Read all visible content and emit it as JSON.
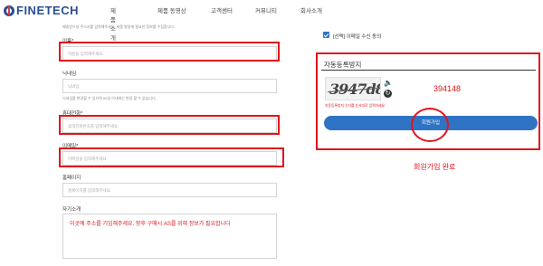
{
  "header": {
    "logo_text": "FINETECH",
    "nav": [
      "제품소개",
      "제품 동영상",
      "고객센터",
      "커뮤니티",
      "회사소개"
    ]
  },
  "form": {
    "top_hint": "배송받으실 주소지를 입력해주세요. 제품 발송에 필요한 정보를 수집합니다.",
    "name": {
      "label": "이름*",
      "placeholder": "이름을 입력해주세요."
    },
    "nickname": {
      "label": "닉네임",
      "placeholder": "닉네임",
      "note": "닉네임을 변경할 수 있으며 60일 이내에는 변경 할 수 없습니다."
    },
    "phone": {
      "label": "휴대전화*",
      "placeholder": "휴대전화번호를 입력해주세요."
    },
    "email": {
      "label": "이메일*",
      "placeholder": "이메일을 입력해주세요."
    },
    "homepage": {
      "label": "홈페이지",
      "placeholder": "홈페이지를 입력해주세요."
    },
    "intro": {
      "label": "자기소개",
      "text": "이곳에 주소를 기입해주세요. 향후 구매시 AS를 위해 정보가 필요합니다"
    }
  },
  "right": {
    "email_opt_in": "[선택] 이메일 수신 동의",
    "captcha": {
      "title": "자동등록방지",
      "image_text": "3947d8",
      "sound_icon": "speaker-icon",
      "refresh_icon": "refresh-icon",
      "input_value": "394148",
      "note": "자동등록방지 숫자를 순서대로 입력하세요."
    },
    "submit_label": "회원가입",
    "annotation": "회원가입 완료"
  },
  "colors": {
    "accent": "#2f74c4",
    "highlight": "#e2141b",
    "brand": "#2b4f92"
  }
}
